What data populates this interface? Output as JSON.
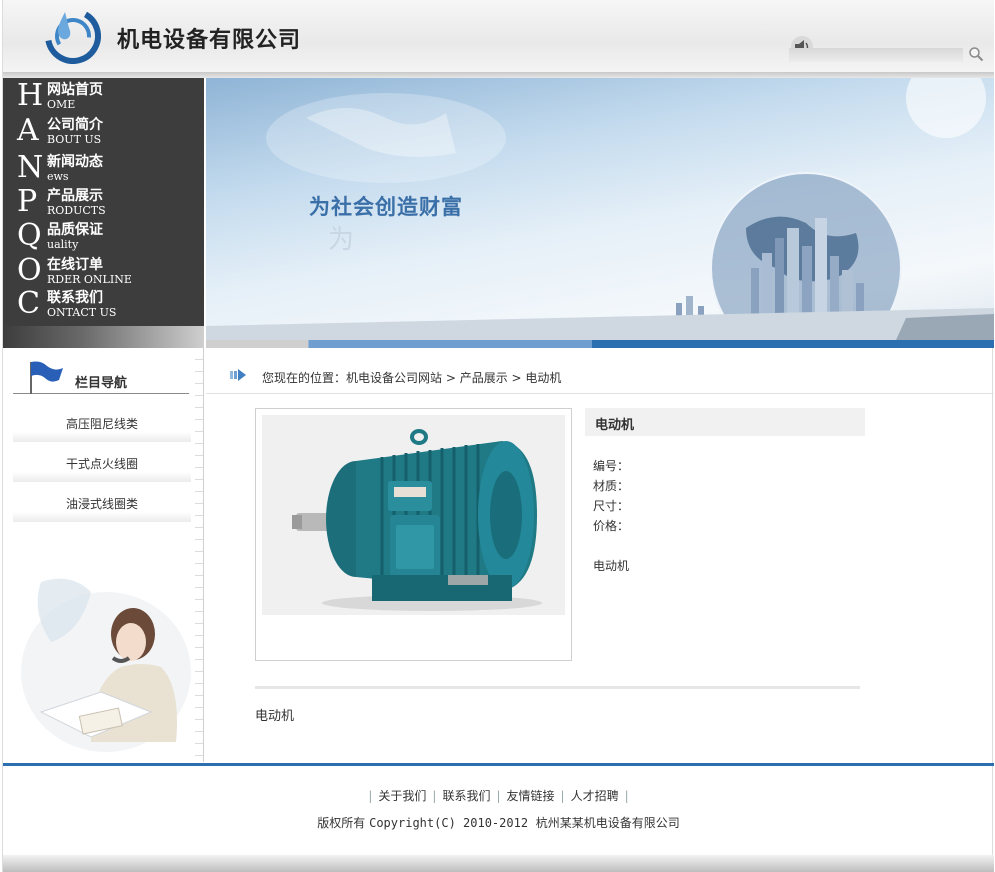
{
  "header": {
    "company_name": "机电设备有限公司",
    "search_placeholder": ""
  },
  "nav": [
    {
      "letter": "H",
      "cn": "网站首页",
      "en": "OME"
    },
    {
      "letter": "A",
      "cn": "公司简介",
      "en": "BOUT US"
    },
    {
      "letter": "N",
      "cn": "新闻动态",
      "en": "ews"
    },
    {
      "letter": "P",
      "cn": "产品展示",
      "en": "RODUCTS"
    },
    {
      "letter": "Q",
      "cn": "品质保证",
      "en": "uality"
    },
    {
      "letter": "O",
      "cn": "在线订单",
      "en": "RDER ONLINE"
    },
    {
      "letter": "C",
      "cn": "联系我们",
      "en": "ONTACT US"
    }
  ],
  "banner": {
    "slogan": "为社会创造财富"
  },
  "sidebar": {
    "title": "栏目导航",
    "links": [
      "高压阻尼线类",
      "干式点火线圈",
      "油浸式线圈类"
    ]
  },
  "breadcrumb": {
    "prefix": "您现在的位置：",
    "site": "机电设备公司网站",
    "sep1": " > ",
    "category": "产品展示",
    "sep2": " > ",
    "current": "电动机"
  },
  "product": {
    "name": "电动机",
    "specs": {
      "number": "编号：",
      "material": "材质：",
      "size": "尺寸：",
      "price": "价格："
    },
    "short_desc": "电动机",
    "description": "电动机"
  },
  "footer": {
    "links": [
      "关于我们",
      "联系我们",
      "友情链接",
      "人才招聘"
    ],
    "copyright_prefix": "版权所有 ",
    "copyright_text": "Copyright(C) 2010-2012",
    "copyright_company": "  杭州某某机电设备有限公司"
  },
  "colors": {
    "accent": "#2c6fb0",
    "nav_bg": "#3d3d3d",
    "motor": "#1f7a86"
  }
}
